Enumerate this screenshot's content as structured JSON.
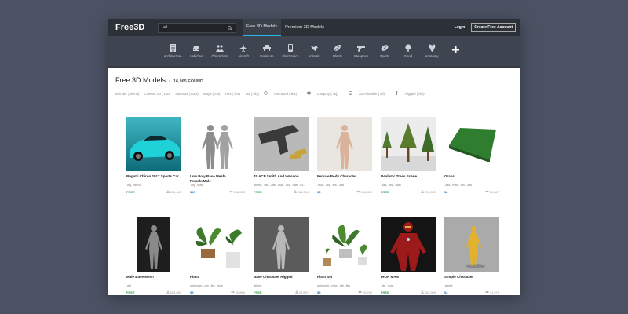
{
  "header": {
    "logo": "Free3D",
    "search_value": "all",
    "tabs": [
      {
        "label": "Free 3D Models",
        "active": true
      },
      {
        "label": "Premium 3D Models",
        "active": false
      }
    ],
    "login": "Login",
    "create_account": "Create Free Account"
  },
  "categories": [
    {
      "label": "Architecture",
      "icon": "building-icon"
    },
    {
      "label": "Vehicles",
      "icon": "car-icon"
    },
    {
      "label": "Characters",
      "icon": "people-icon"
    },
    {
      "label": "Aircraft",
      "icon": "airplane-icon"
    },
    {
      "label": "Furniture",
      "icon": "sofa-icon"
    },
    {
      "label": "Electronics",
      "icon": "phone-icon"
    },
    {
      "label": "Animals",
      "icon": "bird-icon"
    },
    {
      "label": "Plants",
      "icon": "leaf-icon"
    },
    {
      "label": "Weapons",
      "icon": "gun-icon"
    },
    {
      "label": "Sports",
      "icon": "ball-icon"
    },
    {
      "label": "Food",
      "icon": "food-icon"
    },
    {
      "label": "Anatomy",
      "icon": "anatomy-icon"
    },
    {
      "label": "",
      "icon": "plus-icon"
    }
  ],
  "page": {
    "title": "Free 3D Models",
    "separator": "/",
    "found": "16,965 FOUND"
  },
  "filters": [
    "Blender (.blend)",
    "Cinema 4D (.c4d)",
    "3ds Max (.max)",
    "Maya (.ma)",
    "FBX (.fbx)",
    ".obj (.obj)"
  ],
  "filter_flags": [
    {
      "label": "Animated (.fbx)",
      "icon": "animated-icon"
    },
    {
      "label": "Lowpoly (.obj)",
      "icon": "lowpoly-icon"
    },
    {
      "label": "3D Printable (.stl)",
      "icon": "printer-icon"
    },
    {
      "label": "Rigged (.fbx)",
      "icon": "rigged-icon"
    }
  ],
  "colors": {
    "free": "#3aa14a",
    "paid": "#2b7cc4",
    "active_tab": "#26b5e7"
  },
  "models": [
    {
      "name": "Bugatti Chiron 2017 Sports Car",
      "formats": ".obj, .blend",
      "price": "FREE",
      "stat": "206,465",
      "stat_icon": "download-icon",
      "thumb": "car"
    },
    {
      "name": "Low Poly Base Mesh-Female/Male",
      "formats": ".obj, .max",
      "price": "$15",
      "stat": "188,505",
      "stat_icon": "eye-icon",
      "thumb": "couple"
    },
    {
      "name": "45 ACP Smith And Wesson",
      "formats": ".blend, .fbx, .3ds, .max, .obj, .dae, .x3...",
      "price": "FREE",
      "stat": "285,314",
      "stat_icon": "download-icon",
      "thumb": "gun"
    },
    {
      "name": "Female Body Character",
      "formats": ".max, .obj, .fbx, .3ds",
      "price": "$6",
      "stat": "304,525",
      "stat_icon": "eye-icon",
      "thumb": "female"
    },
    {
      "name": "Realistic Trees Scene",
      "formats": ".3ds, .obj, .max",
      "price": "FREE",
      "stat": "215,825",
      "stat_icon": "download-icon",
      "thumb": "trees"
    },
    {
      "name": "Grass",
      "formats": ".3ds, .max, .fbx, .3ds",
      "price": "$6",
      "stat": "76,867",
      "stat_icon": "eye-icon",
      "thumb": "grass"
    },
    {
      "name": "Male Base Mesh",
      "formats": ".obj",
      "price": "FREE",
      "stat": "383,585",
      "stat_icon": "download-icon",
      "thumb": "male"
    },
    {
      "name": "Plant",
      "formats": "unknown, .obj, .fbx, .max",
      "price": "$8",
      "stat": "52,869",
      "stat_icon": "eye-icon",
      "thumb": "plant"
    },
    {
      "name": "Base Character Rigged",
      "formats": ".blend",
      "price": "FREE",
      "stat": "26,867",
      "stat_icon": "download-icon",
      "thumb": "base"
    },
    {
      "name": "Plant Set",
      "formats": "unknown, .max, .obj, .fbx",
      "price": "$8",
      "stat": "25,780",
      "stat_icon": "eye-icon",
      "thumb": "plantset"
    },
    {
      "name": "IRON MAN",
      "formats": ".obj, .max",
      "price": "FREE",
      "stat": "302,965",
      "stat_icon": "download-icon",
      "thumb": "ironman"
    },
    {
      "name": "Simple Character",
      "formats": ".blend",
      "price": "$2",
      "stat": "41,578",
      "stat_icon": "eye-icon",
      "thumb": "simple"
    }
  ]
}
